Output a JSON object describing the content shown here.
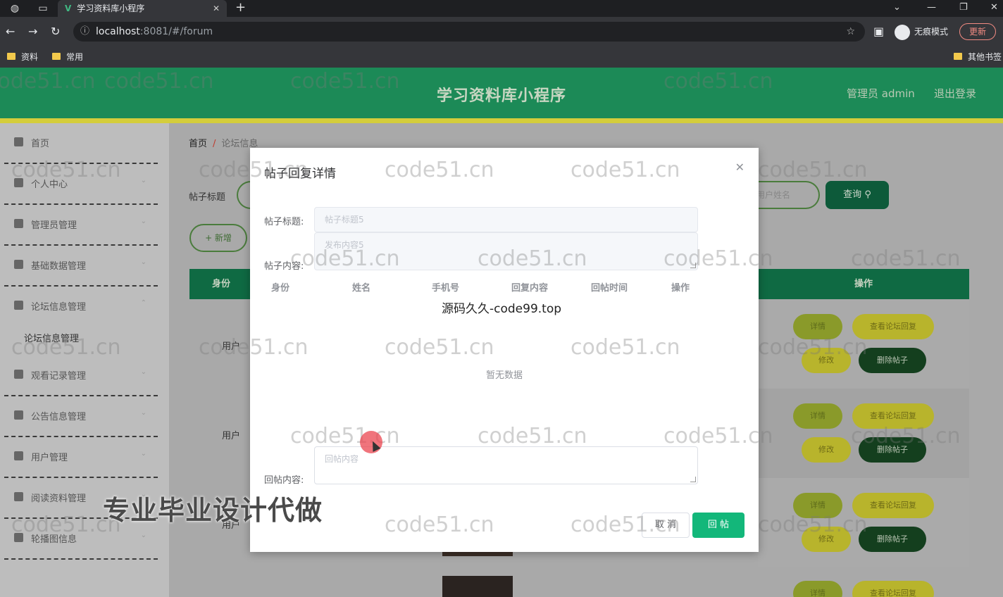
{
  "browser": {
    "tab_title": "学习资料库小程序",
    "url_host": "localhost",
    "url_rest": ":8081/#/forum",
    "profile_label": "无痕模式",
    "update_label": "更新",
    "bookmarks": [
      "资料",
      "常用"
    ],
    "other_bookmarks": "其他书签"
  },
  "header": {
    "title": "学习资料库小程序",
    "admin": "管理员 admin",
    "logout": "退出登录",
    "accent": "#1c8a57",
    "strip": "#d4cd3b"
  },
  "sidebar": {
    "items": [
      {
        "label": "首页",
        "icon": "home-icon"
      },
      {
        "label": "个人中心",
        "icon": "user-icon"
      },
      {
        "label": "管理员管理",
        "icon": "admin-icon"
      },
      {
        "label": "基础数据管理",
        "icon": "data-icon"
      },
      {
        "label": "论坛信息管理",
        "icon": "forum-icon"
      },
      {
        "label": "观看记录管理",
        "icon": "history-icon"
      },
      {
        "label": "公告信息管理",
        "icon": "notice-icon"
      },
      {
        "label": "用户管理",
        "icon": "users-icon"
      },
      {
        "label": "阅读资料管理",
        "icon": "book-icon"
      },
      {
        "label": "轮播图信息",
        "icon": "carousel-icon"
      }
    ],
    "sub_active": "论坛信息管理"
  },
  "main": {
    "breadcrumb_home": "首页",
    "breadcrumb_current": "论坛信息",
    "search_label": "帖子标题",
    "search_placeholder_tail": "用户姓名",
    "query_button": "查询",
    "add_button": "+ 新增",
    "table_head_left": "身份",
    "table_head_right": "操作",
    "rows": [
      {
        "role": "用户"
      },
      {
        "role": "用户"
      },
      {
        "role": "用户"
      }
    ],
    "actions": {
      "detail": "详情",
      "view_replies": "查看论坛回复",
      "edit": "修改",
      "delete": "删除帖子"
    }
  },
  "dialog": {
    "title": "帖子回复详情",
    "post_title_label": "帖子标题:",
    "post_title_value": "帖子标题5",
    "post_content_label": "帖子内容:",
    "post_content_value": "发布内容5",
    "columns": [
      "身份",
      "姓名",
      "手机号",
      "回复内容",
      "回帖时间",
      "操作"
    ],
    "empty_text": "暂无数据",
    "reply_label": "回帖内容:",
    "reply_placeholder": "回帖内容",
    "cancel_label": "取 消",
    "submit_label": "回 帖"
  },
  "overlays": {
    "code_text": "源码久久-code99.top",
    "promo_text": "专业毕业设计代做",
    "watermark": "code51.cn"
  }
}
